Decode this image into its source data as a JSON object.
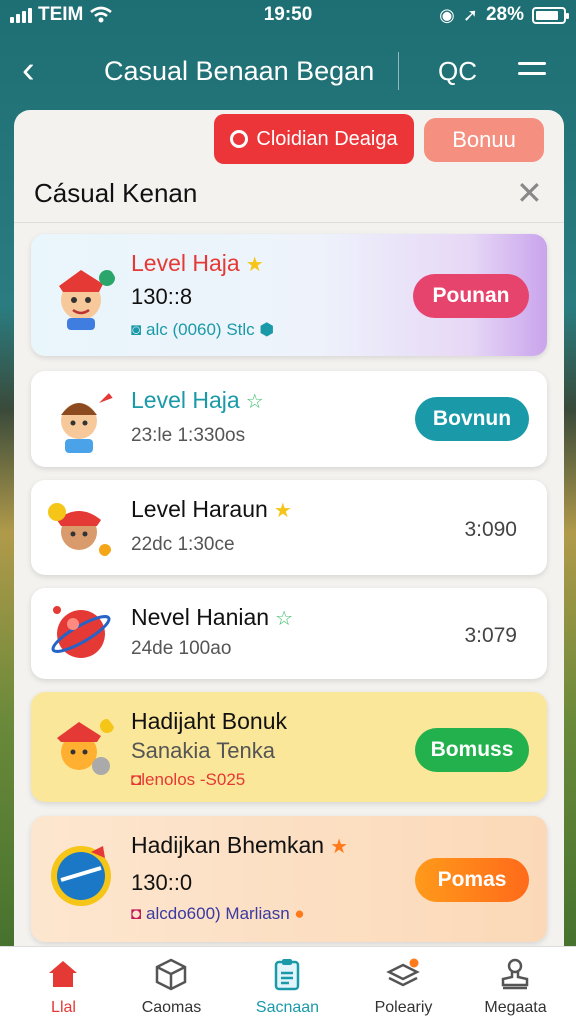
{
  "status": {
    "carrier": "TEIM",
    "time": "19:50",
    "battery": "28%"
  },
  "nav": {
    "title": "Casual Benaan Began",
    "action": "QC"
  },
  "sheet": {
    "red_button": "Cloidian Deaiga",
    "bonus_button": "Bonuu",
    "title": "Cásual Kenan"
  },
  "cards": [
    {
      "title": "Level Haja",
      "subtitle": "130::8",
      "meta": "alc (0060) Stlc",
      "button": "Pounan"
    },
    {
      "title": "Level Haja",
      "subtitle": "23:le 1:330os",
      "button": "Bovnun"
    },
    {
      "title": "Level Haraun",
      "subtitle": "22dc 1:30ce",
      "value": "3:090"
    },
    {
      "title": "Nevel Hanian",
      "subtitle": "24de 100ao",
      "value": "3:079"
    },
    {
      "title": "Hadijaht Bonuk",
      "subtitle": "Sanakia Tenka",
      "meta": "lenolos -S025",
      "button": "Bomuss"
    },
    {
      "title": "Hadijkan Bhemkan",
      "subtitle": "130::0",
      "meta": "alcdo600) Marliasn",
      "button": "Pomas"
    }
  ],
  "tabs": [
    {
      "label": "Llal",
      "icon": "home-icon"
    },
    {
      "label": "Caomas",
      "icon": "box-icon"
    },
    {
      "label": "Sacnaan",
      "icon": "clipboard-icon"
    },
    {
      "label": "Poleariy",
      "icon": "layers-icon"
    },
    {
      "label": "Megaata",
      "icon": "stamp-icon"
    }
  ],
  "colors": {
    "accent_red": "#ec3538",
    "teal": "#1a9aa8",
    "green": "#22b14c",
    "orange": "#ff7a1a",
    "pink": "#e6436d"
  }
}
